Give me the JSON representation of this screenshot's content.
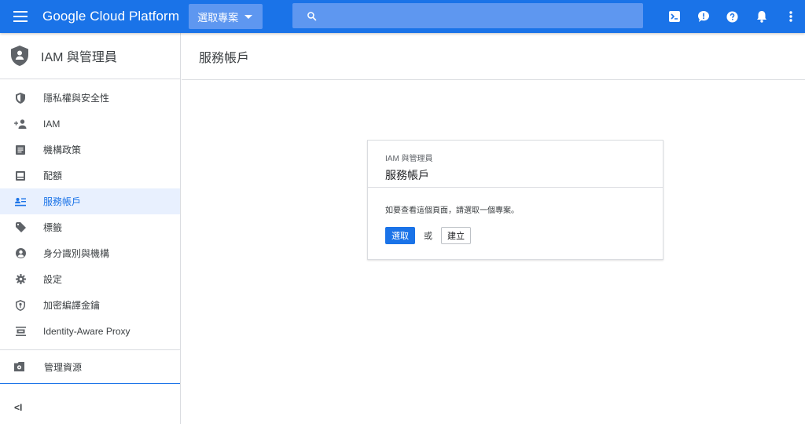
{
  "topbar": {
    "brand": "Google Cloud Platform",
    "project_select_label": "選取專案",
    "search_placeholder": "",
    "accent_color": "#1a73e8",
    "icons": [
      "menu-icon",
      "search-icon",
      "cloud-shell-icon",
      "feedback-icon",
      "help-icon",
      "notifications-icon",
      "more-vert-icon"
    ]
  },
  "sidebar": {
    "title": "IAM 與管理員",
    "items": [
      {
        "label": "隱私權與安全性",
        "icon": "shield-icon",
        "active": false
      },
      {
        "label": "IAM",
        "icon": "person-add-icon",
        "active": false
      },
      {
        "label": "機構政策",
        "icon": "document-icon",
        "active": false
      },
      {
        "label": "配額",
        "icon": "quota-icon",
        "active": false
      },
      {
        "label": "服務帳戶",
        "icon": "service-account-icon",
        "active": true
      },
      {
        "label": "標籤",
        "icon": "label-icon",
        "active": false
      },
      {
        "label": "身分識別與機構",
        "icon": "account-circle-icon",
        "active": false
      },
      {
        "label": "設定",
        "icon": "gear-icon",
        "active": false
      },
      {
        "label": "加密編譯金鑰",
        "icon": "key-shield-icon",
        "active": false
      },
      {
        "label": "Identity-Aware Proxy",
        "icon": "proxy-icon",
        "active": false
      }
    ],
    "manage_resources": "管理資源",
    "collapse_label": "<I"
  },
  "main": {
    "title": "服務帳戶",
    "card": {
      "subtitle": "IAM 與管理員",
      "title": "服務帳戶",
      "message": "如要查看這個頁面，請選取一個專案。",
      "select_label": "選取",
      "or_label": "或",
      "create_label": "建立"
    }
  }
}
